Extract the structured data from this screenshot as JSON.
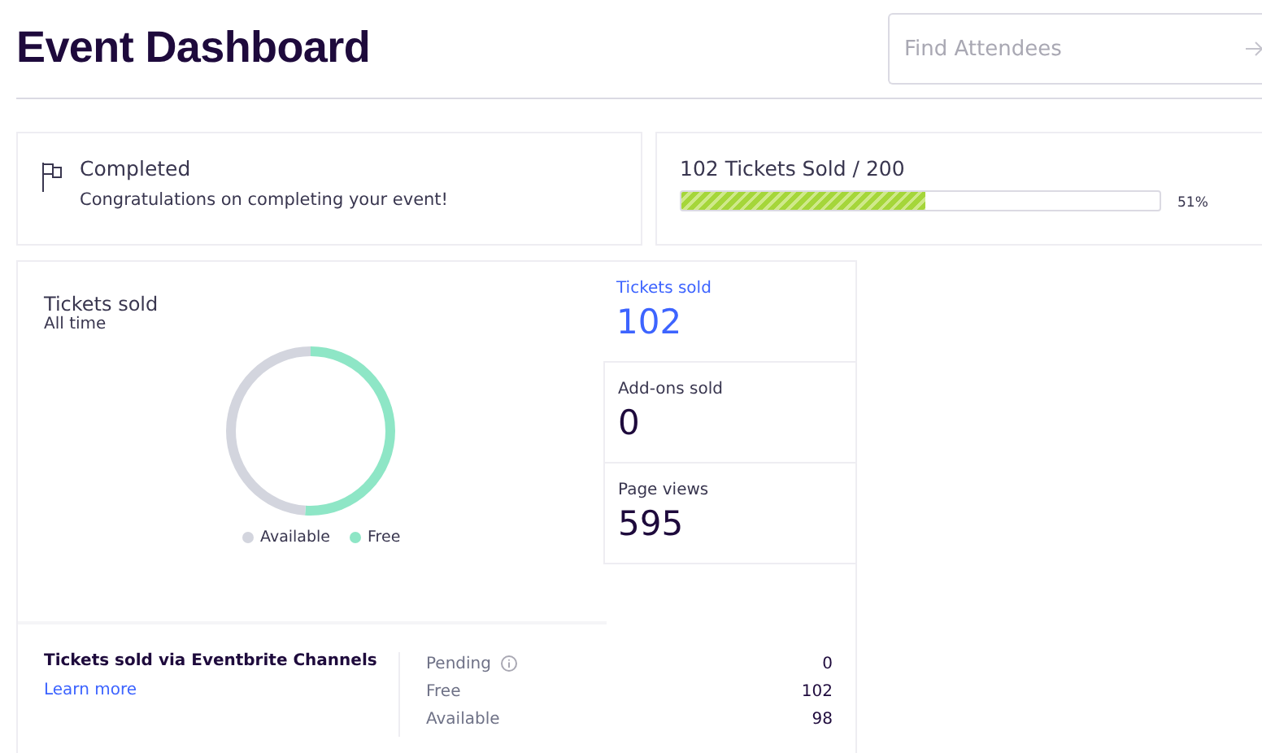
{
  "header": {
    "title": "Event Dashboard",
    "search": {
      "placeholder": "Find Attendees"
    }
  },
  "status_card": {
    "title": "Completed",
    "message": "Congratulations on completing your event!"
  },
  "sales_card": {
    "title": "102 Tickets Sold / 200",
    "level": 0.51,
    "percent": "51%"
  },
  "tickets_chart": {
    "title": "Tickets sold",
    "subtitle": "All time",
    "chart_data": {
      "type": "donut",
      "categories": [
        "Available",
        "Free"
      ],
      "values": [
        49,
        51
      ],
      "colors": [
        "#d3d5de",
        "#8ee6c6"
      ]
    }
  },
  "stats": [
    {
      "label": "Tickets sold",
      "value": "102",
      "selected": true
    },
    {
      "label": "Add-ons sold",
      "value": "0",
      "selected": false
    },
    {
      "label": "Page views",
      "value": "595",
      "selected": false
    }
  ],
  "channels": {
    "title": "Tickets sold via Eventbrite Channels",
    "link": "Learn more",
    "rows": [
      {
        "label": "Pending",
        "value": "0",
        "info": true
      },
      {
        "label": "Free",
        "value": "102",
        "info": false
      },
      {
        "label": "Available",
        "value": "98",
        "info": false
      }
    ]
  }
}
